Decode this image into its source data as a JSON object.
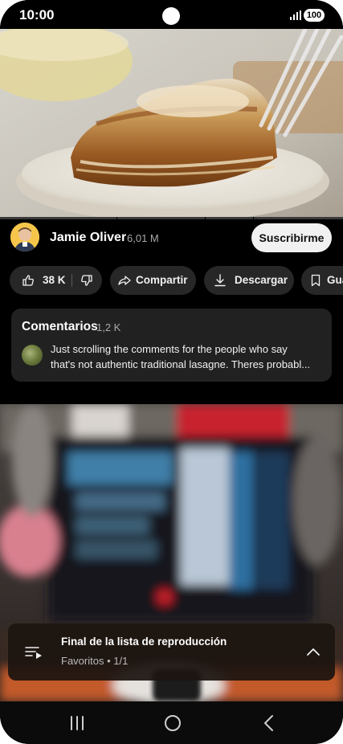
{
  "status_bar": {
    "time": "10:00",
    "battery": "100",
    "icons": [
      "camera-cutout",
      "signal-icon",
      "battery-icon"
    ]
  },
  "video": {
    "description_icons": [
      "video-frame"
    ]
  },
  "channel": {
    "name": "Jamie Oliver",
    "subscribers": "6,01 M",
    "subscribe_label": "Suscribirme"
  },
  "actions": {
    "likes": "38 K",
    "share_label": "Compartir",
    "download_label": "Descargar",
    "save_label": "Gua",
    "icons": [
      "thumb-up-icon",
      "thumb-down-icon",
      "share-icon",
      "download-icon",
      "bookmark-icon"
    ]
  },
  "comments": {
    "title": "Comentarios",
    "count": "1,2 K",
    "top_comment_line1": "Just scrolling the comments for the people who say",
    "top_comment_line2": "that's not authentic traditional lasagne. Theres probabl..."
  },
  "playlist": {
    "title": "Final de la lista de reproducción",
    "subtitle": "Favoritos • 1/1",
    "icons": [
      "playlist-play-icon",
      "chevron-up-icon"
    ]
  },
  "nav_bar": {
    "icons": [
      "recent-apps-icon",
      "home-icon",
      "back-icon"
    ]
  },
  "colors": {
    "background": "#000000",
    "chip": "#272727",
    "card": "#212121",
    "subscribe": "#f1f1f1"
  }
}
